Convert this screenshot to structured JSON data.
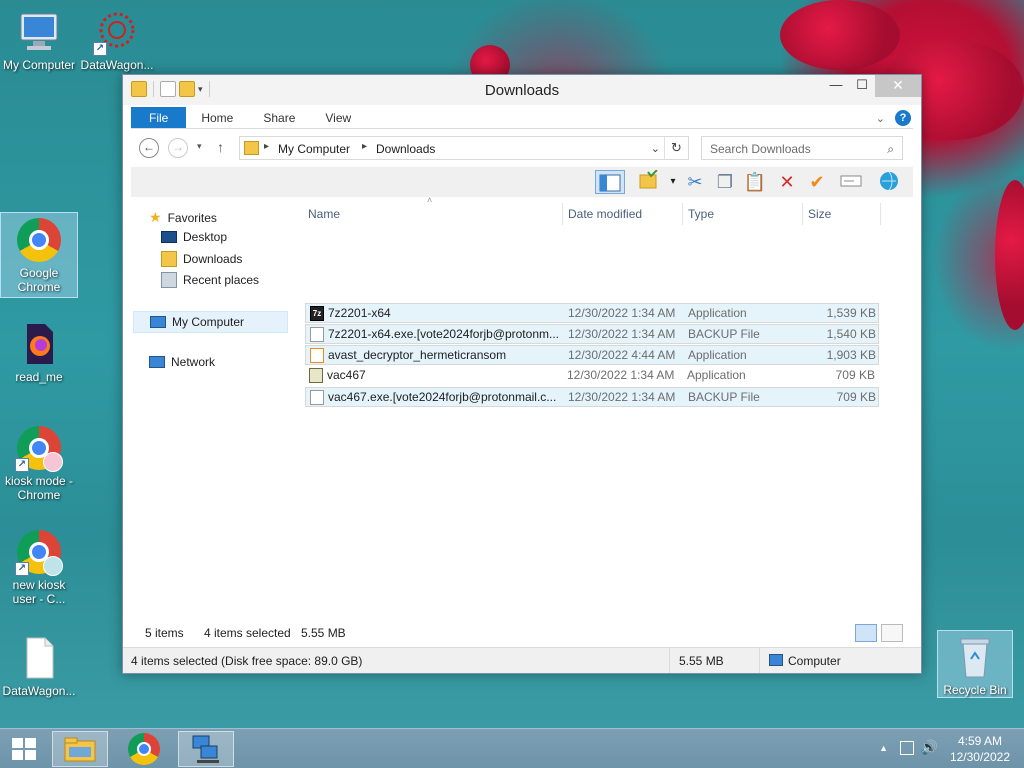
{
  "desktop": {
    "icons": [
      {
        "label": "My Computer"
      },
      {
        "label": "DataWagon..."
      },
      {
        "label": "Google Chrome"
      },
      {
        "label": "read_me"
      },
      {
        "label": "kiosk mode - Chrome"
      },
      {
        "label": "new kiosk user - C..."
      },
      {
        "label": "DataWagon..."
      },
      {
        "label": "Recycle Bin"
      }
    ]
  },
  "window": {
    "title": "Downloads",
    "close_glyph": "✕",
    "ribbon_tabs": [
      "File",
      "Home",
      "Share",
      "View"
    ],
    "address": {
      "crumbs": [
        "My Computer",
        "Downloads"
      ]
    },
    "search": {
      "placeholder": "Search Downloads"
    },
    "nav_pane": {
      "favorites": "Favorites",
      "desktop": "Desktop",
      "downloads": "Downloads",
      "recent": "Recent places",
      "computer": "My Computer",
      "network": "Network"
    },
    "columns": [
      "Name",
      "Date modified",
      "Type",
      "Size"
    ],
    "files": [
      {
        "name": "7z2201-x64",
        "date": "12/30/2022 1:34 AM",
        "type": "Application",
        "size": "1,539 KB",
        "selected": true
      },
      {
        "name": "7z2201-x64.exe.[vote2024forjb@protonm...",
        "date": "12/30/2022 1:34 AM",
        "type": "BACKUP File",
        "size": "1,540 KB",
        "selected": true
      },
      {
        "name": "avast_decryptor_hermeticransom",
        "date": "12/30/2022 4:44 AM",
        "type": "Application",
        "size": "1,903 KB",
        "selected": true
      },
      {
        "name": "vac467",
        "date": "12/30/2022 1:34 AM",
        "type": "Application",
        "size": "709 KB",
        "selected": false
      },
      {
        "name": "vac467.exe.[vote2024forjb@protonmail.c...",
        "date": "12/30/2022 1:34 AM",
        "type": "BACKUP File",
        "size": "709 KB",
        "selected": true
      }
    ],
    "status": {
      "items": "5 items",
      "selected": "4 items selected",
      "size": "5.55 MB",
      "detail": "4 items selected (Disk free space: 89.0 GB)",
      "size2": "5.55 MB",
      "location": "Computer"
    }
  },
  "taskbar": {
    "time": "4:59 AM",
    "date": "12/30/2022"
  },
  "colors": {
    "accent": "#1979ca",
    "selection": "#e5f3fb",
    "taskbar": "#6e94a9"
  }
}
